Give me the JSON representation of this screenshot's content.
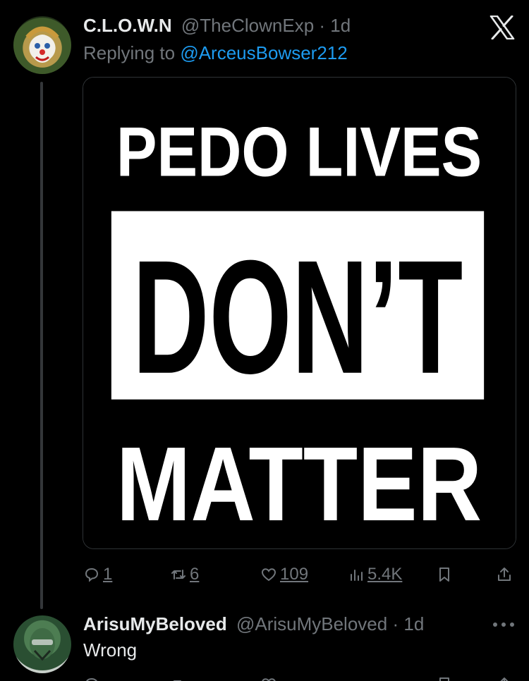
{
  "tweet": {
    "display_name": "C.L.O.W.N",
    "handle": "@TheClownExp",
    "separator": "·",
    "time": "1d",
    "replying_to_label": "Replying to",
    "replying_to_handle": "@ArceusBowser212",
    "image_text": {
      "line1": "PEDO LIVES",
      "line2": "DON’T",
      "line3": "MATTER"
    },
    "actions": {
      "reply_count": "1",
      "retweet_count": "6",
      "like_count": "109",
      "view_count": "5.4K"
    }
  },
  "reply": {
    "display_name": "ArisuMyBeloved",
    "handle": "@ArisuMyBeloved",
    "separator": "·",
    "time": "1d",
    "text": "Wrong"
  },
  "colors": {
    "background": "#000000",
    "link": "#1d9bf0",
    "muted": "#71767b",
    "text": "#e7e9ea"
  }
}
